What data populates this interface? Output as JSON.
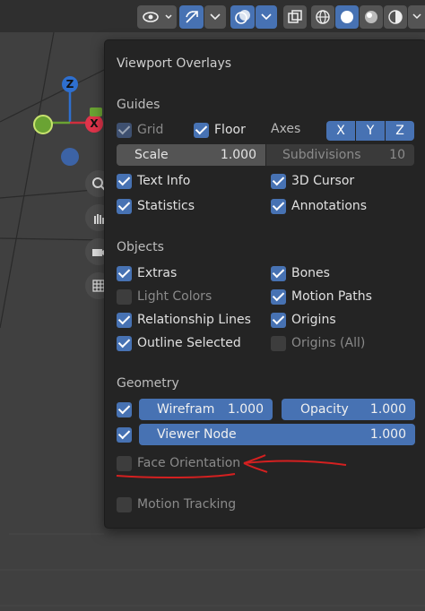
{
  "header": {
    "icons": [
      "eye-icon",
      "gizmo-icon",
      "overlay-icon",
      "xray-icon",
      "wireframe-shading-icon",
      "solid-shading-icon",
      "material-shading-icon",
      "rendered-shading-icon"
    ]
  },
  "gizmo": {
    "z": "Z",
    "x": "X"
  },
  "popover": {
    "title": "Viewport Overlays",
    "guides": {
      "heading": "Guides",
      "grid": "Grid",
      "floor": "Floor",
      "axes": "Axes",
      "axis_x": "X",
      "axis_y": "Y",
      "axis_z": "Z",
      "scale_label": "Scale",
      "scale_value": "1.000",
      "subdivisions_label": "Subdivisions",
      "subdivisions_value": "10",
      "text_info": "Text Info",
      "cursor_3d": "3D Cursor",
      "statistics": "Statistics",
      "annotations": "Annotations"
    },
    "objects": {
      "heading": "Objects",
      "extras": "Extras",
      "bones": "Bones",
      "light_colors": "Light Colors",
      "motion_paths": "Motion Paths",
      "relationship_lines": "Relationship Lines",
      "origins": "Origins",
      "outline_selected": "Outline Selected",
      "origins_all": "Origins (All)"
    },
    "geometry": {
      "heading": "Geometry",
      "wireframe_label": "Wirefram",
      "wireframe_value": "1.000",
      "opacity_label": "Opacity",
      "opacity_value": "1.000",
      "viewer_node_label": "Viewer Node",
      "viewer_node_value": "1.000",
      "face_orientation": "Face Orientation"
    },
    "motion_tracking": "Motion Tracking"
  },
  "colors": {
    "accent": "#4772b3",
    "annotation": "#d42020"
  }
}
